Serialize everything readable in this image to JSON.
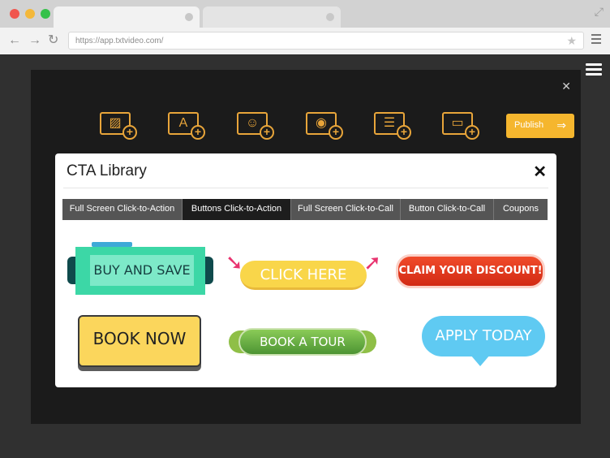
{
  "browser": {
    "url": "https://app.txtvideo.com/",
    "icons": [
      "back-arrow-icon",
      "forward-arrow-icon",
      "reload-icon",
      "star-icon",
      "menu-icon",
      "expand-icon"
    ]
  },
  "editor": {
    "tools": [
      "image-add-icon",
      "text-add-icon",
      "person-add-icon",
      "camera-add-icon",
      "caption-add-icon",
      "cta-add-icon"
    ],
    "tool_glyphs": [
      "▨",
      "A",
      "☺",
      "◉",
      "☰",
      "▭"
    ],
    "publish_label": "Publish",
    "accent": "#f5b62e"
  },
  "modal": {
    "title": "CTA Library",
    "close": "✕",
    "tabs": [
      {
        "label": "Full Screen Click-to-Action",
        "active": false
      },
      {
        "label": "Buttons Click-to-Action",
        "active": true
      },
      {
        "label": "Full Screen Click-to-Call",
        "active": false
      },
      {
        "label": "Button Click-to-Call",
        "active": false
      },
      {
        "label": "Coupons",
        "active": false
      }
    ],
    "ctas": {
      "buy_and_save": "BUY AND SAVE",
      "click_here": "CLICK HERE",
      "claim_discount": "CLAIM YOUR DISCOUNT!",
      "book_now": "BOOK NOW",
      "book_tour": "BOOK A TOUR",
      "apply_today": "APPLY TODAY"
    }
  }
}
